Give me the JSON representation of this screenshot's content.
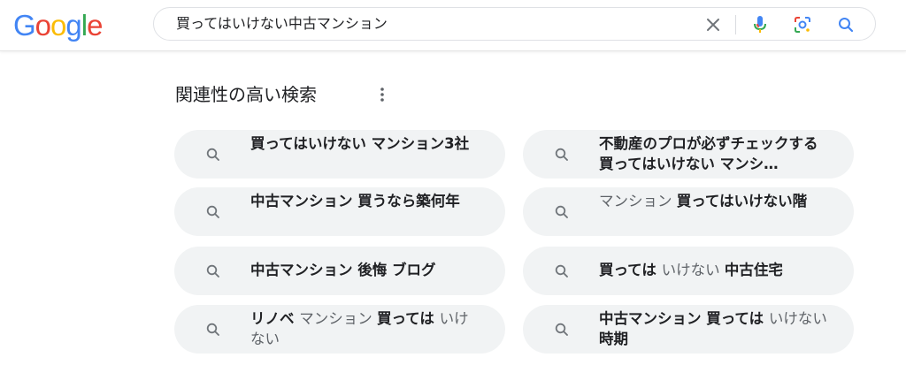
{
  "logo": {
    "letters": [
      "G",
      "o",
      "o",
      "g",
      "l",
      "e"
    ],
    "colors": [
      "#4285F4",
      "#EA4335",
      "#FBBC05",
      "#4285F4",
      "#34A853",
      "#EA4335"
    ]
  },
  "search": {
    "query": "買ってはいけない中古マンション"
  },
  "icons": {
    "clear": "close-icon",
    "voice": "microphone-icon",
    "lens": "lens-icon",
    "search": "search-icon"
  },
  "related": {
    "title": "関連性の高い検索",
    "more_icon": "more-vert-icon",
    "chips": [
      {
        "parts": [
          {
            "t": "買ってはいけない マンション3社",
            "b": true
          }
        ]
      },
      {
        "parts": [
          {
            "t": "不動産のプロが必ずチェックする買ってはいけない マンシ…",
            "b": true
          }
        ]
      },
      {
        "parts": [
          {
            "t": "中古マンション 買うなら築何年",
            "b": true
          }
        ]
      },
      {
        "parts": [
          {
            "t": "マンション ",
            "b": false
          },
          {
            "t": "買ってはいけない階",
            "b": true
          }
        ]
      },
      {
        "parts": [
          {
            "t": "中古マンション 後悔 ブログ",
            "b": true
          }
        ]
      },
      {
        "parts": [
          {
            "t": "買っては ",
            "b": true
          },
          {
            "t": "いけない ",
            "b": false
          },
          {
            "t": "中古住宅",
            "b": true
          }
        ]
      },
      {
        "parts": [
          {
            "t": "リノベ ",
            "b": true
          },
          {
            "t": "マンション ",
            "b": false
          },
          {
            "t": "買っては ",
            "b": true
          },
          {
            "t": "いけない",
            "b": false
          }
        ]
      },
      {
        "parts": [
          {
            "t": "中古マンション 買っては ",
            "b": true
          },
          {
            "t": "いけない ",
            "b": false
          },
          {
            "t": "時期",
            "b": true
          }
        ]
      }
    ]
  }
}
